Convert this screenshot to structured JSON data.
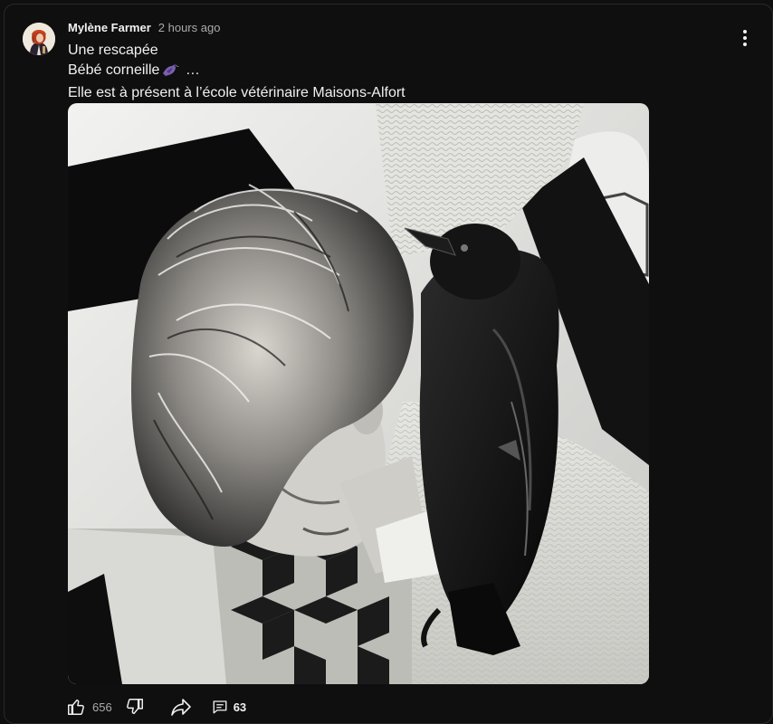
{
  "post": {
    "author": "Mylène Farmer",
    "timestamp": "2 hours ago",
    "text": {
      "line1": "Une rescapée",
      "line2_prefix": "Bébé corneille",
      "line2_emoji": "bird-icon",
      "line2_suffix": "…",
      "line3": "Elle est à présent à l’école vétérinaire Maisons-Alfort"
    },
    "image": "black-and-white photo of a woman with a baby crow on her shoulder"
  },
  "actions": {
    "like_icon": "thumbs-up-icon",
    "like_count": "656",
    "dislike_icon": "thumbs-down-icon",
    "share_icon": "share-icon",
    "comment_icon": "comment-icon",
    "comment_count": "63"
  },
  "colors": {
    "background": "#0f0f0f",
    "text_primary": "#f1f1f1",
    "text_secondary": "#aaaaaa"
  }
}
